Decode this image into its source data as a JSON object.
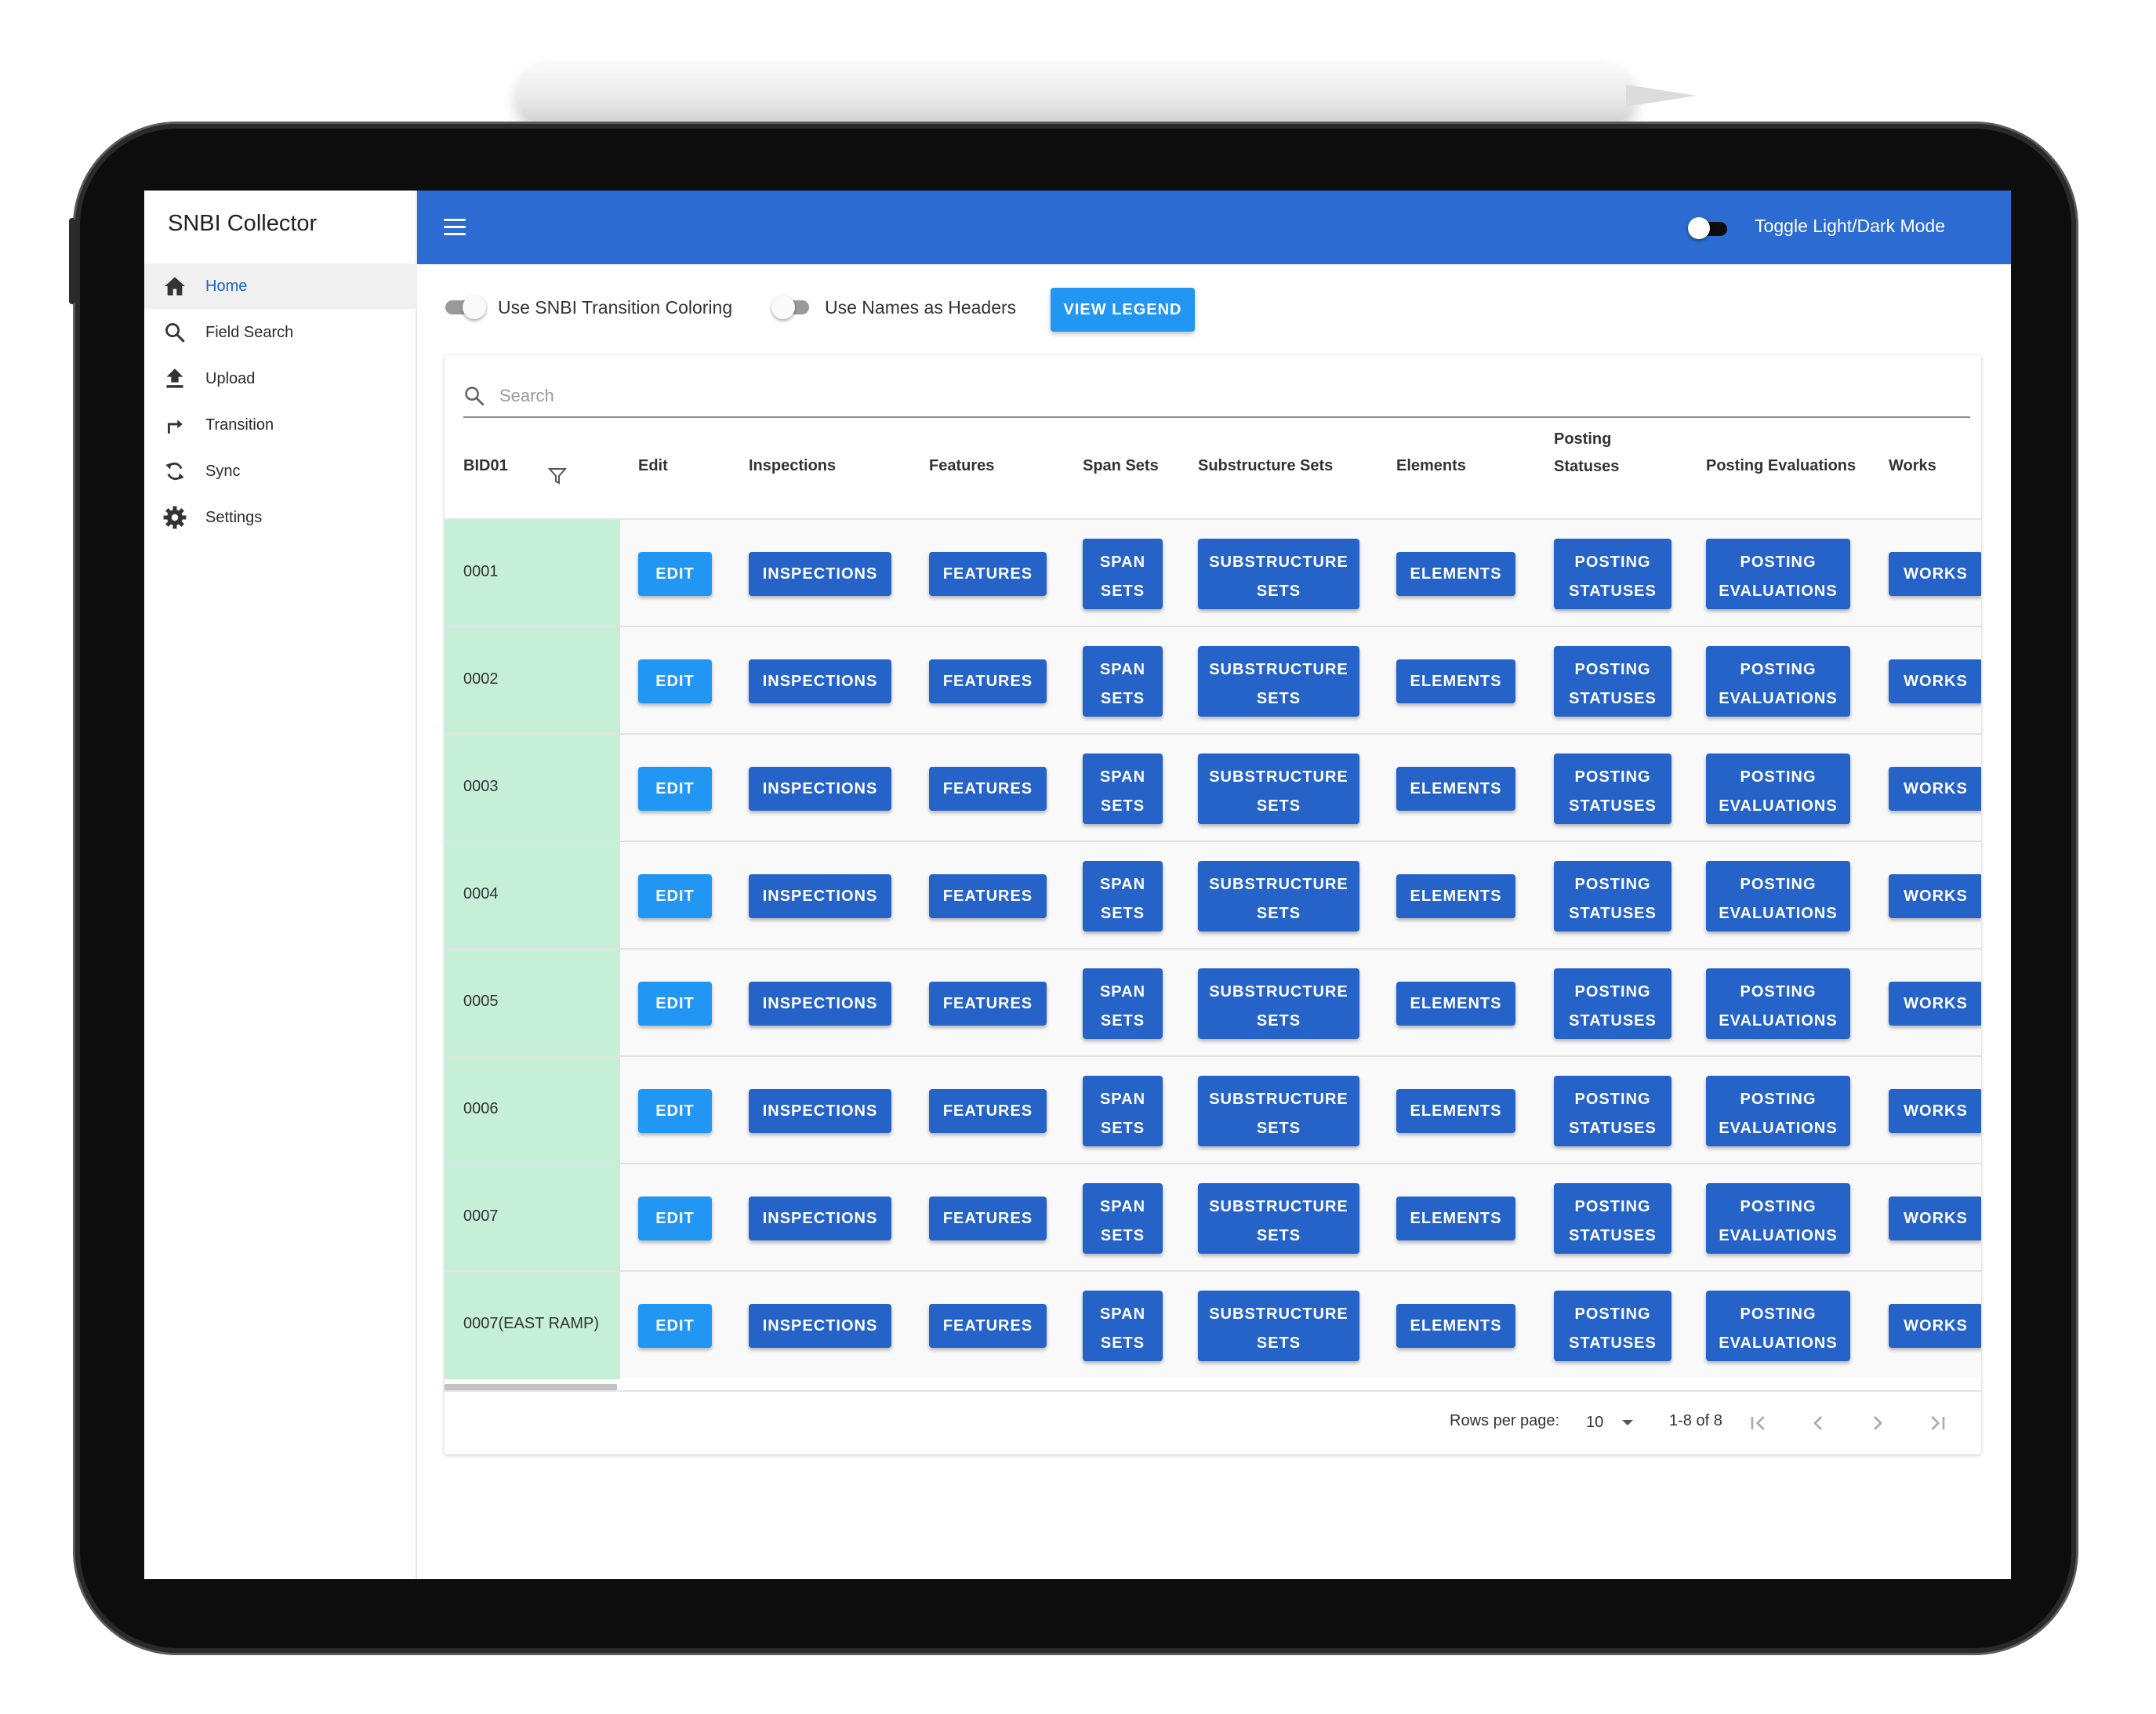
{
  "sidebar": {
    "title": "SNBI Collector",
    "items": [
      {
        "label": "Home",
        "icon": "home-icon",
        "active": true
      },
      {
        "label": "Field Search",
        "icon": "search-icon"
      },
      {
        "label": "Upload",
        "icon": "upload-icon"
      },
      {
        "label": "Transition",
        "icon": "arrow-turn-icon"
      },
      {
        "label": "Sync",
        "icon": "sync-icon"
      },
      {
        "label": "Settings",
        "icon": "gear-icon"
      }
    ]
  },
  "topbar": {
    "theme_toggle_label": "Toggle Light/Dark Mode"
  },
  "controls": {
    "transition_coloring_label": "Use SNBI Transition Coloring",
    "names_as_headers_label": "Use Names as Headers",
    "legend_button": "VIEW LEGEND"
  },
  "search": {
    "placeholder": "Search"
  },
  "table": {
    "headers": {
      "bid": "BID01",
      "edit": "Edit",
      "inspections": "Inspections",
      "features": "Features",
      "span_sets": "Span Sets",
      "substructure_sets": "Substructure Sets",
      "elements": "Elements",
      "posting_statuses_1": "Posting",
      "posting_statuses_2": "Statuses",
      "posting_evaluations": "Posting Evaluations",
      "works": "Works"
    },
    "buttons": {
      "edit": "EDIT",
      "inspections": "INSPECTIONS",
      "features": "FEATURES",
      "span_1": "SPAN",
      "span_2": "SETS",
      "sub_1": "SUBSTRUCTURE",
      "sub_2": "SETS",
      "elements": "ELEMENTS",
      "ps_1": "POSTING",
      "ps_2": "STATUSES",
      "pe_1": "POSTING",
      "pe_2": "EVALUATIONS",
      "works": "WORKS"
    },
    "rows": [
      "0001",
      "0002",
      "0003",
      "0004",
      "0005",
      "0006",
      "0007",
      "0007(EAST RAMP)"
    ]
  },
  "footer": {
    "rows_per_page_label": "Rows per page:",
    "rows_per_page_value": "10",
    "page_range": "1-8 of 8"
  },
  "colors": {
    "accent": "#2b6bd2",
    "button": "#2563c9",
    "edit_button": "#2196f3",
    "id_cell": "#c6efd7"
  }
}
